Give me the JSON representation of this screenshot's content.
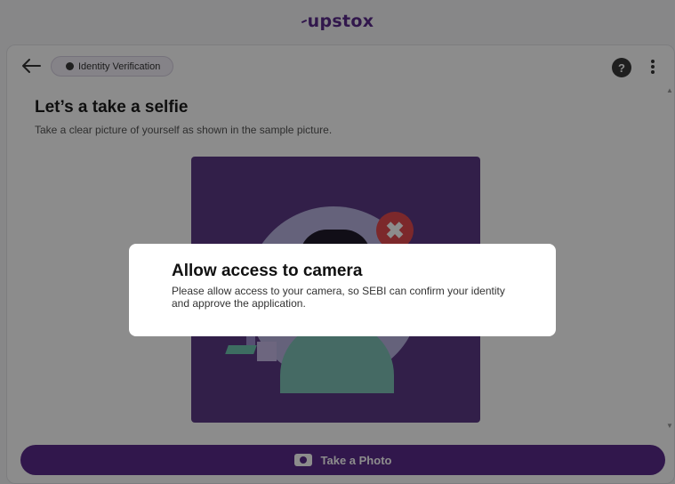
{
  "header": {
    "logo_text": "upstox"
  },
  "toolbar": {
    "back_icon": "arrow-left-icon",
    "chip_label": "Identity Verification",
    "help_label": "?",
    "menu_icon": "kebab-menu-icon"
  },
  "main": {
    "title": "Let’s a take a selfie",
    "subtitle": "Take a clear picture of yourself as shown in the sample picture.",
    "sample_colors": {
      "background": "#5b3a86",
      "face_circle": "#b9b3e0",
      "x_mark": "#e24a4f"
    },
    "x_mark_glyph": "✖"
  },
  "footer": {
    "take_photo_label": "Take a Photo"
  },
  "dialog": {
    "title": "Allow access to camera",
    "message": "Please allow access to your camera, so SEBI can confirm your identity and approve the application."
  },
  "colors": {
    "brand": "#5a2a8a",
    "overlay": "rgba(0,0,0,0.45)"
  }
}
